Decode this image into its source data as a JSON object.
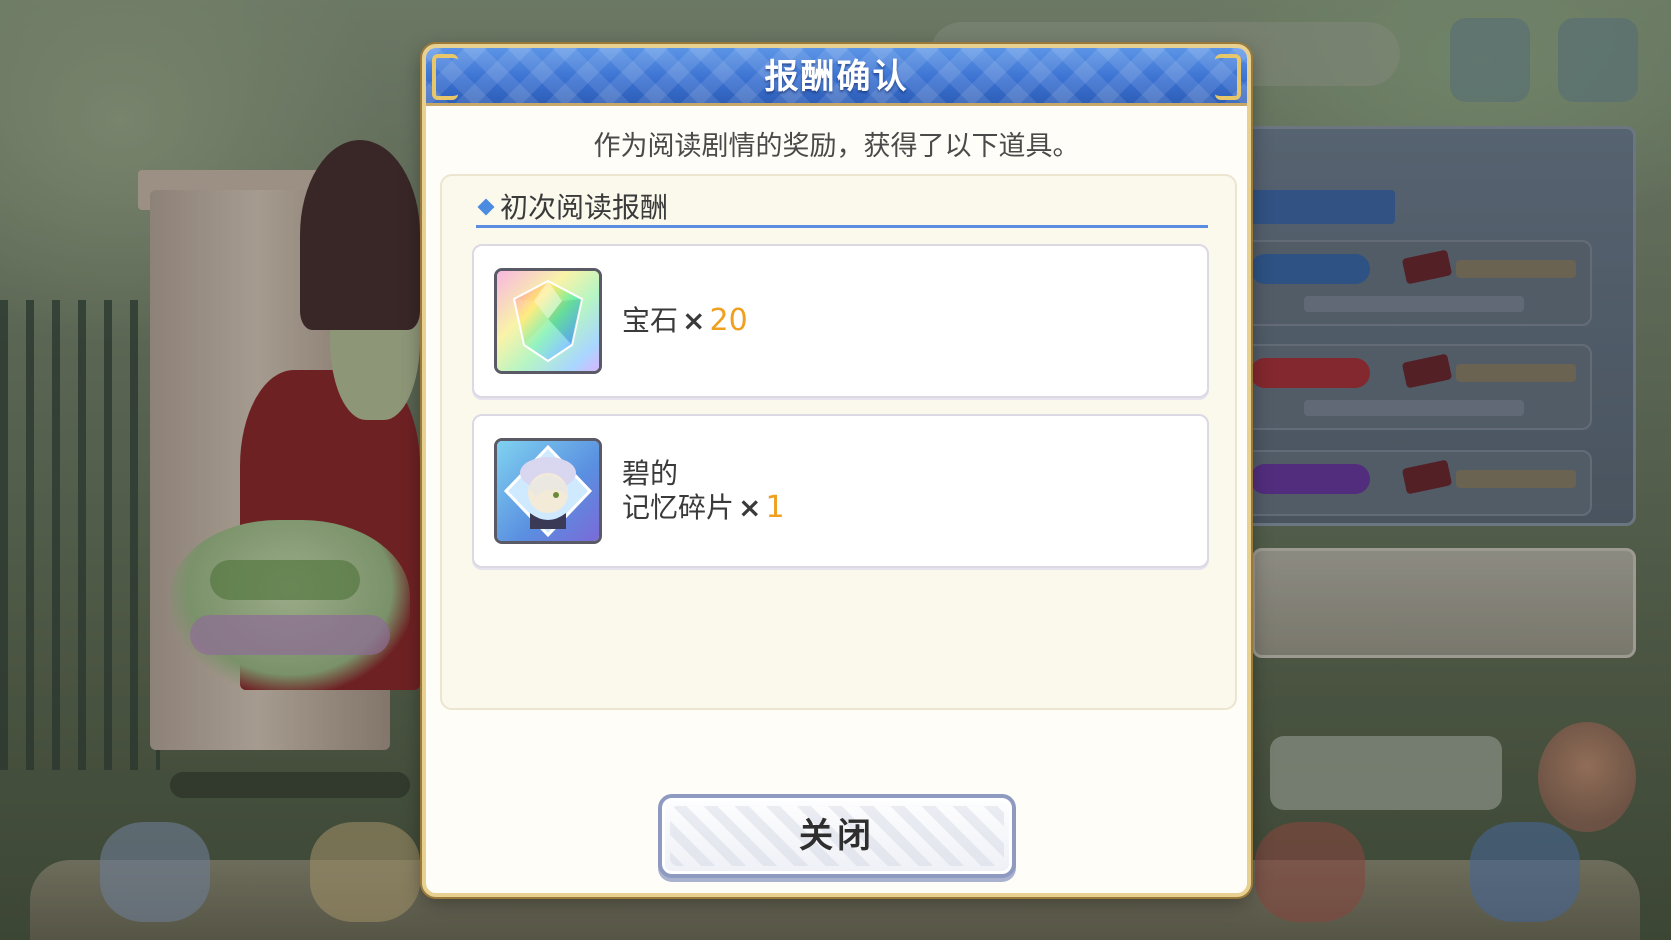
{
  "dialog": {
    "title": "报酬确认",
    "subtitle": "作为阅读剧情的奖励，获得了以下道具。",
    "section_heading": "初次阅读报酬",
    "rewards": [
      {
        "name": "宝石",
        "name_line2": "",
        "times": "×",
        "quantity": "20",
        "icon": "rainbow-gem-icon"
      },
      {
        "name": "碧的",
        "name_line2": "记忆碎片",
        "times": "×",
        "quantity": "1",
        "icon": "character-memory-fragment-icon"
      }
    ],
    "close_label": "关闭"
  },
  "colors": {
    "header_blue": "#3a70d0",
    "heading_rule": "#5b8ee0",
    "quantity_orange": "#f0a020",
    "gold_border": "#e8d090"
  }
}
